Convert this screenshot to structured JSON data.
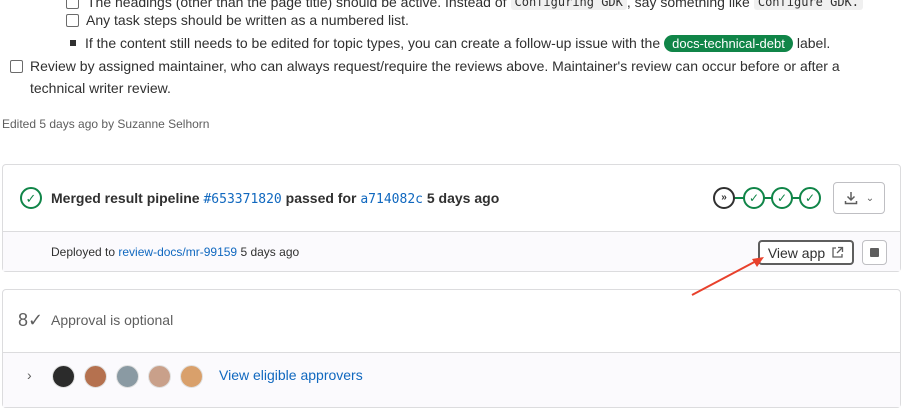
{
  "checklist": {
    "partial_line": {
      "prefix": "The headings (other than the page title) should be active. Instead of",
      "code1": "Configuring GDK",
      "middle": ", say something like",
      "code2": "Configure GDK."
    },
    "task_steps": "Any task steps should be written as a numbered list.",
    "followup": {
      "prefix": "If the content still needs to be edited for topic types, you can create a follow-up issue with the",
      "label": "docs-technical-debt",
      "suffix": "label."
    },
    "review_line1": "Review by assigned maintainer, who can always request/require the reviews above. Maintainer's review can occur before or after a",
    "review_line2": "technical writer review."
  },
  "edited": "Edited 5 days ago by Suzanne Selhorn",
  "pipeline": {
    "prefix": "Merged result pipeline",
    "id": "#653371820",
    "middle": "passed for",
    "commit": "a714082c",
    "time": "5 days ago",
    "stage_icons": [
      "skip-forward-icon",
      "check-icon",
      "check-icon",
      "check-icon"
    ]
  },
  "deploy": {
    "prefix": "Deployed to",
    "env": "review-docs/mr-99159",
    "time": "5 days ago",
    "view_app": "View app"
  },
  "approval": {
    "text": "Approval is optional",
    "eligible": "View eligible approvers",
    "avatar_colors": [
      "#2b2b2b",
      "#b5714f",
      "#8a9aa3",
      "#c9a08a",
      "#d9a06b"
    ]
  },
  "colors": {
    "success": "#108548",
    "link": "#1068bf",
    "annotation": "#e8412c"
  }
}
